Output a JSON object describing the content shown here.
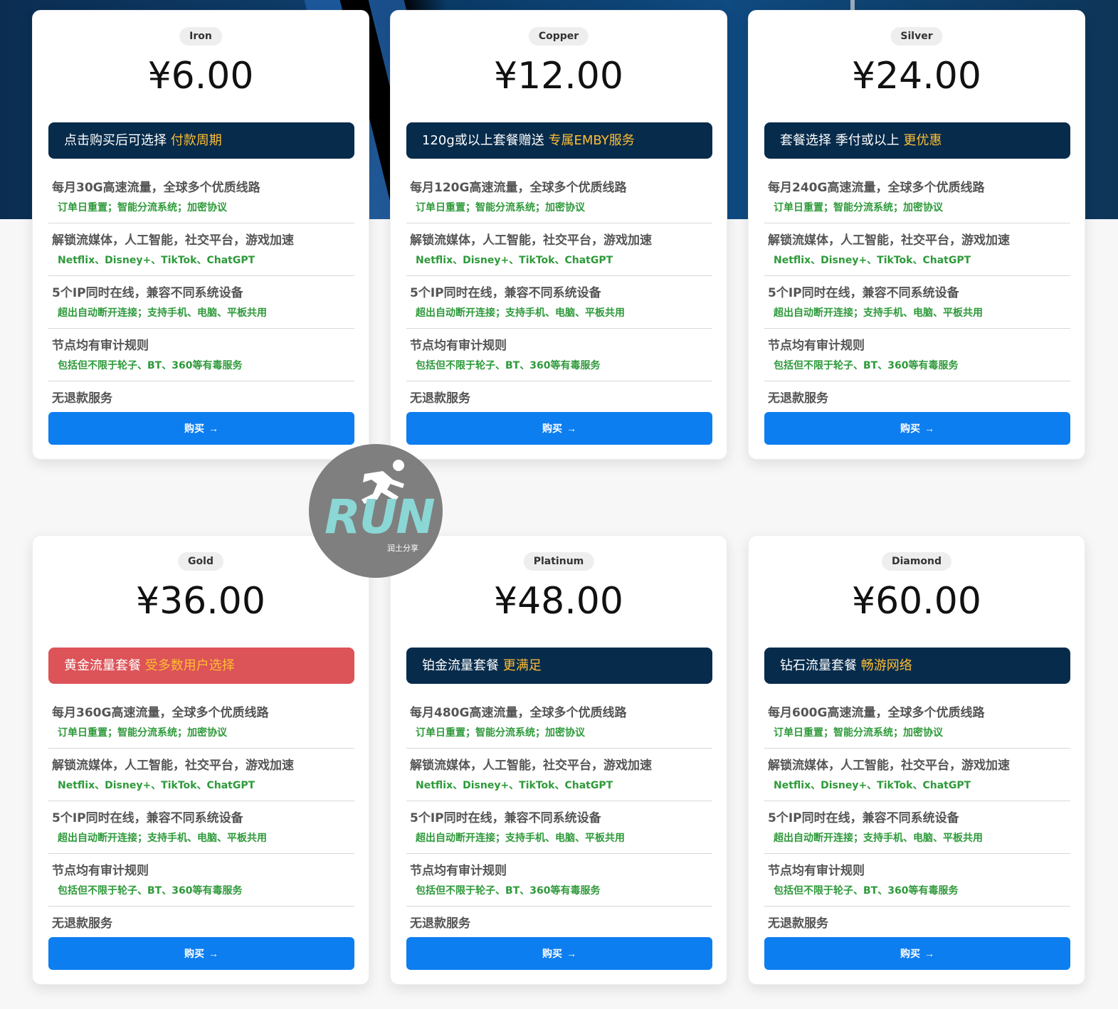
{
  "plans": [
    {
      "tier": "Iron",
      "price": "¥6.00",
      "banner_text": "点击购买后可选择 ",
      "banner_highlight": "付款周期",
      "banner_color": "#072b4b",
      "features": [
        {
          "title": "每月30G高速流量，全球多个优质线路",
          "sub": "订单日重置；智能分流系统；加密协议"
        },
        {
          "title": "解锁流媒体，人工智能，社交平台，游戏加速",
          "sub": "Netflix、Disney+、TikTok、ChatGPT"
        },
        {
          "title": "5个IP同时在线，兼容不同系统设备",
          "sub": "超出自动断开连接；支持手机、电脑、平板共用"
        },
        {
          "title": "节点均有审计规则",
          "sub": "包括但不限于轮子、BT、360等有毒服务"
        },
        {
          "title": "无退款服务",
          "sub": ""
        }
      ],
      "buy_label": "购买",
      "buy_icon": "arrow-right-icon"
    },
    {
      "tier": "Copper",
      "price": "¥12.00",
      "banner_text": "120g或以上套餐赠送 ",
      "banner_highlight": "专属EMBY服务",
      "banner_color": "#072b4b",
      "features": [
        {
          "title": "每月120G高速流量，全球多个优质线路",
          "sub": "订单日重置；智能分流系统；加密协议"
        },
        {
          "title": "解锁流媒体，人工智能，社交平台，游戏加速",
          "sub": "Netflix、Disney+、TikTok、ChatGPT"
        },
        {
          "title": "5个IP同时在线，兼容不同系统设备",
          "sub": "超出自动断开连接；支持手机、电脑、平板共用"
        },
        {
          "title": "节点均有审计规则",
          "sub": "包括但不限于轮子、BT、360等有毒服务"
        },
        {
          "title": "无退款服务",
          "sub": ""
        }
      ],
      "buy_label": "购买",
      "buy_icon": "arrow-right-icon"
    },
    {
      "tier": "Silver",
      "price": "¥24.00",
      "banner_text": "套餐选择 季付或以上 ",
      "banner_highlight": "更优惠",
      "banner_color": "#072b4b",
      "features": [
        {
          "title": "每月240G高速流量，全球多个优质线路",
          "sub": "订单日重置；智能分流系统；加密协议"
        },
        {
          "title": "解锁流媒体，人工智能，社交平台，游戏加速",
          "sub": "Netflix、Disney+、TikTok、ChatGPT"
        },
        {
          "title": "5个IP同时在线，兼容不同系统设备",
          "sub": "超出自动断开连接；支持手机、电脑、平板共用"
        },
        {
          "title": "节点均有审计规则",
          "sub": "包括但不限于轮子、BT、360等有毒服务"
        },
        {
          "title": "无退款服务",
          "sub": ""
        }
      ],
      "buy_label": "购买",
      "buy_icon": "arrow-right-icon"
    },
    {
      "tier": "Gold",
      "price": "¥36.00",
      "banner_text": "黄金流量套餐 ",
      "banner_highlight": "受多数用户选择",
      "banner_color": "#dc5358",
      "features": [
        {
          "title": "每月360G高速流量，全球多个优质线路",
          "sub": "订单日重置；智能分流系统；加密协议"
        },
        {
          "title": "解锁流媒体，人工智能，社交平台，游戏加速",
          "sub": "Netflix、Disney+、TikTok、ChatGPT"
        },
        {
          "title": "5个IP同时在线，兼容不同系统设备",
          "sub": "超出自动断开连接；支持手机、电脑、平板共用"
        },
        {
          "title": "节点均有审计规则",
          "sub": "包括但不限于轮子、BT、360等有毒服务"
        },
        {
          "title": "无退款服务",
          "sub": ""
        }
      ],
      "buy_label": "购买",
      "buy_icon": "arrow-right-icon"
    },
    {
      "tier": "Platinum",
      "price": "¥48.00",
      "banner_text": "铂金流量套餐 ",
      "banner_highlight": "更满足",
      "banner_color": "#072b4b",
      "features": [
        {
          "title": "每月480G高速流量，全球多个优质线路",
          "sub": "订单日重置；智能分流系统；加密协议"
        },
        {
          "title": "解锁流媒体，人工智能，社交平台，游戏加速",
          "sub": "Netflix、Disney+、TikTok、ChatGPT"
        },
        {
          "title": "5个IP同时在线，兼容不同系统设备",
          "sub": "超出自动断开连接；支持手机、电脑、平板共用"
        },
        {
          "title": "节点均有审计规则",
          "sub": "包括但不限于轮子、BT、360等有毒服务"
        },
        {
          "title": "无退款服务",
          "sub": ""
        }
      ],
      "buy_label": "购买",
      "buy_icon": "arrow-right-icon"
    },
    {
      "tier": "Diamond",
      "price": "¥60.00",
      "banner_text": "钻石流量套餐 ",
      "banner_highlight": "畅游网络",
      "banner_color": "#072b4b",
      "features": [
        {
          "title": "每月600G高速流量，全球多个优质线路",
          "sub": "订单日重置；智能分流系统；加密协议"
        },
        {
          "title": "解锁流媒体，人工智能，社交平台，游戏加速",
          "sub": "Netflix、Disney+、TikTok、ChatGPT"
        },
        {
          "title": "5个IP同时在线，兼容不同系统设备",
          "sub": "超出自动断开连接；支持手机、电脑、平板共用"
        },
        {
          "title": "节点均有审计规则",
          "sub": "包括但不限于轮子、BT、360等有毒服务"
        },
        {
          "title": "无退款服务",
          "sub": ""
        }
      ],
      "buy_label": "购买",
      "buy_icon": "arrow-right-icon"
    }
  ],
  "watermark": {
    "logo_text": "RUN",
    "caption": "润土分享",
    "icon": "running-man-icon"
  },
  "colors": {
    "accent": "#0d7ef0",
    "highlight": "#ffbe33",
    "feature_sub": "#2e9a3a",
    "banner_dark": "#072b4b",
    "banner_red": "#dc5358"
  }
}
